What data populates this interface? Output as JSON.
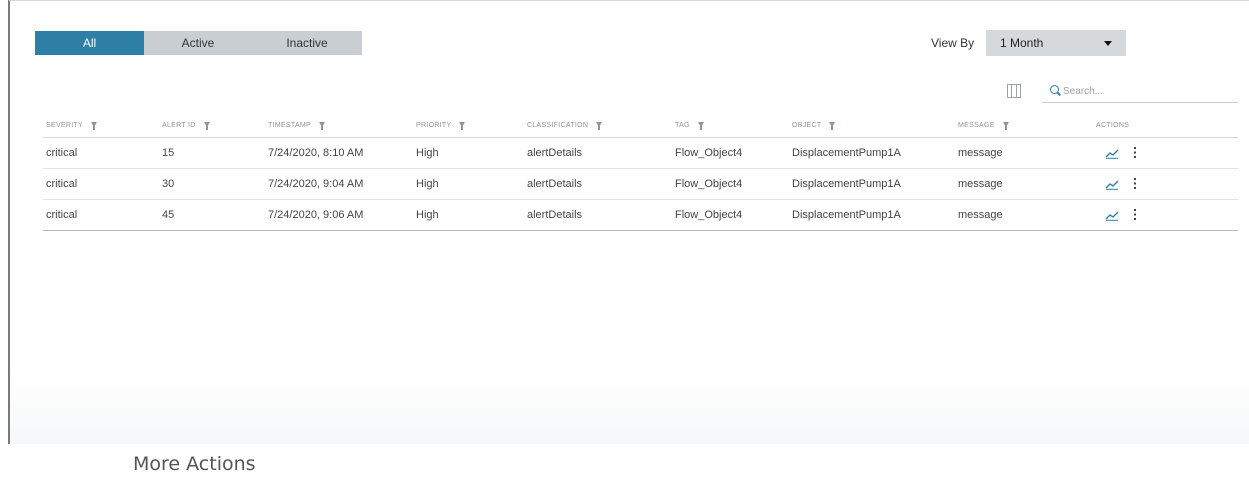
{
  "tabs": [
    "All",
    "Active",
    "Inactive"
  ],
  "view_by": {
    "label": "View By",
    "selected": "1 Month"
  },
  "search": {
    "placeholder": "Search..."
  },
  "table": {
    "columns": [
      "SEVERITY",
      "ALERT ID",
      "TIMESTAMP",
      "PRIORITY",
      "CLASSIFICATION",
      "TAG",
      "OBJECT",
      "MESSAGE",
      "ACTIONS"
    ],
    "rows": [
      [
        "critical",
        "15",
        "7/24/2020, 8:10 AM",
        "High",
        "alertDetails",
        "Flow_Object4",
        "DisplacementPump1A",
        "message"
      ],
      [
        "critical",
        "30",
        "7/24/2020, 9:04 AM",
        "High",
        "alertDetails",
        "Flow_Object4",
        "DisplacementPump1A",
        "message"
      ],
      [
        "critical",
        "45",
        "7/24/2020, 9:06 AM",
        "High",
        "alertDetails",
        "Flow_Object4",
        "DisplacementPump1A",
        "message"
      ]
    ]
  },
  "caption": "More Actions",
  "colors": {
    "accent": "#2e7fa6",
    "tab_inactive": "#c9ced3",
    "select_bg": "#d6d9dc"
  }
}
